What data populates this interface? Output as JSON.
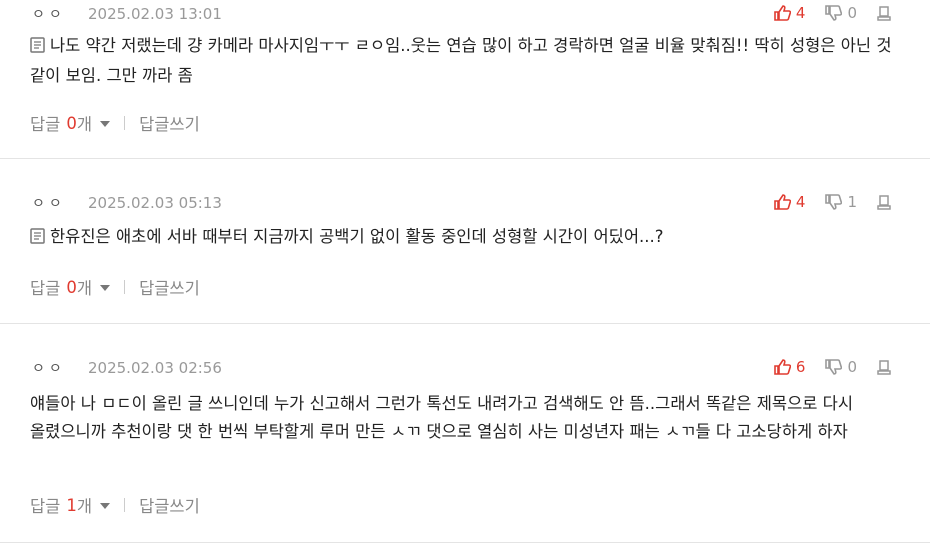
{
  "comments": [
    {
      "nickname": "ㅇㅇ",
      "date": "2025.02.03 13:01",
      "upvotes": "4",
      "downvotes": "0",
      "text": "나도 약간 저랬는데 걍 카메라 마사지임ㅜㅜ ㄹㅇ임..웃는 연습 많이 하고 경락하면 얼굴 비율 맞춰짐!! 딱히 성형은 아닌 것 같이 보임. 그만 까라 좀",
      "has_memo_icon": true,
      "reply_label": "답글",
      "reply_count": "0",
      "reply_unit": "개",
      "write_reply": "답글쓰기"
    },
    {
      "nickname": "ㅇㅇ",
      "date": "2025.02.03 05:13",
      "upvotes": "4",
      "downvotes": "1",
      "text": "한유진은 애초에 서바 때부터 지금까지 공백기 없이 활동 중인데 성형할 시간이 어딨어...?",
      "has_memo_icon": true,
      "reply_label": "답글",
      "reply_count": "0",
      "reply_unit": "개",
      "write_reply": "답글쓰기"
    },
    {
      "nickname": "ㅇㅇ",
      "date": "2025.02.03 02:56",
      "upvotes": "6",
      "downvotes": "0",
      "text": "얘들아 나 ㅁㄷ이 올린 글 쓰니인데 누가 신고해서 그런가 톡선도 내려가고 검색해도 안 뜸..그래서 똑같은 제목으로 다시 올렸으니까 추천이랑 댓 한 번씩 부탁할게 루머 만든 ㅅㄲ 댓으로 열심히 사는 미성년자 패는 ㅅㄲ들 다 고소당하게 하자",
      "has_memo_icon": false,
      "reply_label": "답글",
      "reply_count": "1",
      "reply_unit": "개",
      "write_reply": "답글쓰기"
    }
  ],
  "colors": {
    "accent_red": "#e03b30",
    "muted": "#888888",
    "divider": "#e4e4e4"
  },
  "icons": [
    "thumbs-up-icon",
    "thumbs-down-icon",
    "report-icon",
    "memo-icon",
    "caret-down-icon"
  ]
}
